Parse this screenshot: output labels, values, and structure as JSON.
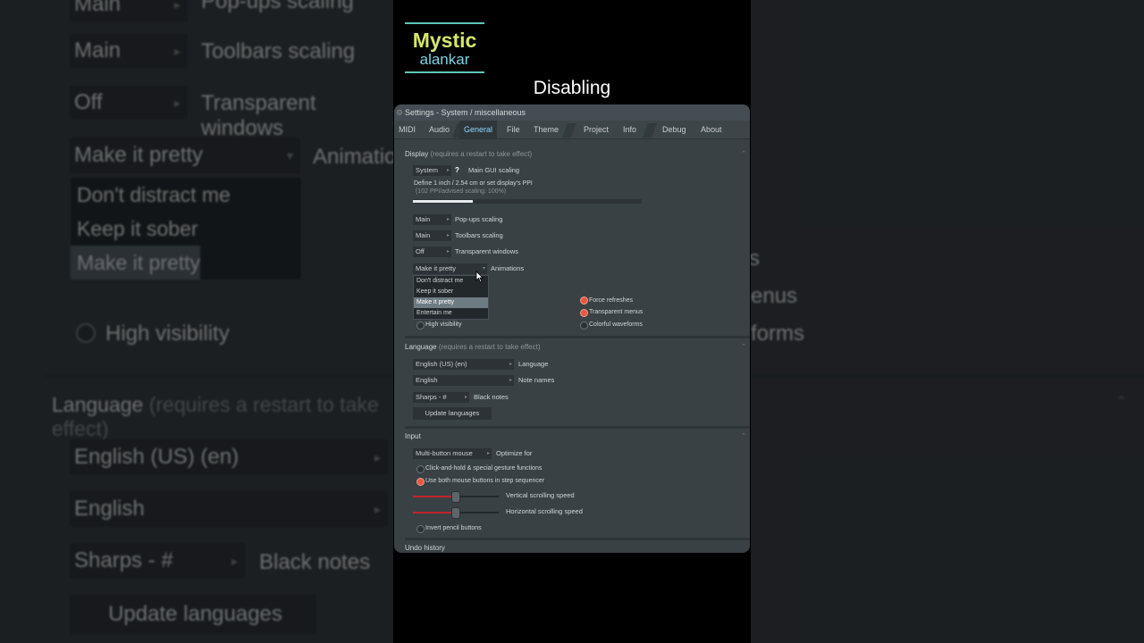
{
  "logo": {
    "line1": "Mystic",
    "line2": "alankar"
  },
  "caption": "Disabling",
  "window": {
    "title": "Settings - System / miscellaneous",
    "tabs": [
      "MIDI",
      "Audio",
      "General",
      "File",
      "Theme",
      "Project",
      "Info",
      "Debug",
      "About"
    ],
    "active_tab": "General"
  },
  "display": {
    "heading": "Display",
    "heading_note": "(requires a restart to take effect)",
    "gui_scaling_value": "System",
    "gui_scaling_help": "?",
    "gui_scaling_label": "Main GUI scaling",
    "ppi_text": "Define 1 inch / 2.54 cm or set display's PPI",
    "ppi_sub": "(102 PPI/advised scaling: 100%)",
    "ppi_progress": 0.26,
    "popups_value": "Main",
    "popups_label": "Pop-ups scaling",
    "toolbars_value": "Main",
    "toolbars_label": "Toolbars scaling",
    "transparent_value": "Off",
    "transparent_label": "Transparent windows",
    "animations_value": "Make it pretty",
    "animations_label": "Animations",
    "animation_options": [
      "Don't distract me",
      "Keep it sober",
      "Make it pretty",
      "Entertain me"
    ],
    "animation_selected_index": 2,
    "high_visibility": "High visibility",
    "force_refreshes": "Force refreshes",
    "transparent_menus": "Transparent menus",
    "colorful_waveforms": "Colorful waveforms"
  },
  "language": {
    "heading": "Language",
    "heading_note": "(requires a restart to take effect)",
    "language_value": "English (US) (en)",
    "language_label": "Language",
    "notes_value": "English",
    "notes_label": "Note names",
    "black_notes_value": "Sharps  - #",
    "black_notes_label": "Black notes",
    "update_button": "Update languages"
  },
  "input": {
    "heading": "Input",
    "optimize_value": "Multi-button mouse",
    "optimize_label": "Optimize for",
    "click_hold": "Click-and-hold & special gesture functions",
    "both_buttons": "Use both mouse buttons in step sequencer",
    "vertical_speed": "Vertical scrolling speed",
    "vertical_level": 0.49,
    "horizontal_speed": "Horizontal scrolling speed",
    "horizontal_level": 0.49,
    "invert_pencil": "Invert pencil buttons"
  },
  "undo": {
    "heading": "Undo history"
  },
  "bg_left": {
    "top_value": "Main",
    "top_label": "Pop-ups scaling",
    "main_value": "Main",
    "main_label": "Toolbars scaling",
    "off_value": "Off",
    "off_label": "Transparent windows",
    "anim_value": "Make it pretty",
    "anim_label": "Animations",
    "options": [
      "Don't distract me",
      "Keep it sober",
      "Make it pretty",
      "Entertain me"
    ],
    "high_visibility": "High visibility",
    "language_heading": "Language",
    "language_note": "(requires a restart to take effect)",
    "language_value": "English (US) (en)",
    "notes_value": "English",
    "black_value": "Sharps  - #",
    "black_label": "Black notes",
    "update_button": "Update languages"
  },
  "bg_right": {
    "force": "s",
    "menus": "enus",
    "waveforms": "forms"
  },
  "colors": {
    "accent_tab": "#8fd4ff",
    "radio_on": "#e3583f",
    "slider_fill": "#c1252b"
  }
}
